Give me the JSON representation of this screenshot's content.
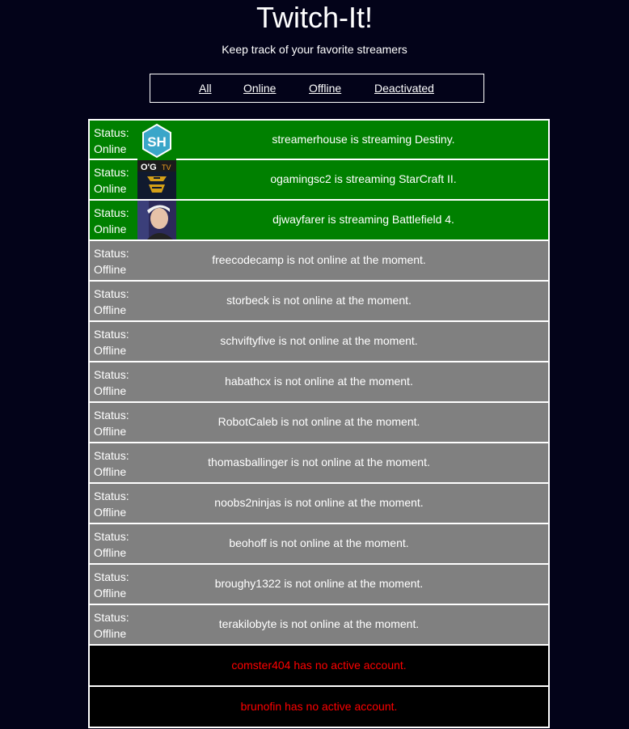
{
  "header": {
    "title": "Twitch-It!",
    "subtitle": "Keep track of your favorite streamers"
  },
  "nav": {
    "all": "All",
    "online": "Online",
    "offline": "Offline",
    "deactivated": "Deactivated"
  },
  "status_label": "Status:",
  "streamers": [
    {
      "state": "Online",
      "message": "streamerhouse is streaming Destiny.",
      "avatar": "streamerhouse-logo"
    },
    {
      "state": "Online",
      "message": "ogamingsc2 is streaming StarCraft II.",
      "avatar": "ogamingsc2-logo"
    },
    {
      "state": "Online",
      "message": "djwayfarer is streaming Battlefield 4.",
      "avatar": "djwayfarer-photo"
    },
    {
      "state": "Offline",
      "message": "freecodecamp is not online at the moment."
    },
    {
      "state": "Offline",
      "message": "storbeck is not online at the moment."
    },
    {
      "state": "Offline",
      "message": "schviftyfive is not online at the moment."
    },
    {
      "state": "Offline",
      "message": "habathcx is not online at the moment."
    },
    {
      "state": "Offline",
      "message": "RobotCaleb is not online at the moment."
    },
    {
      "state": "Offline",
      "message": "thomasballinger is not online at the moment."
    },
    {
      "state": "Offline",
      "message": "noobs2ninjas is not online at the moment."
    },
    {
      "state": "Offline",
      "message": "beohoff is not online at the moment."
    },
    {
      "state": "Offline",
      "message": "broughy1322 is not online at the moment."
    },
    {
      "state": "Offline",
      "message": "terakilobyte is not online at the moment."
    }
  ],
  "deactivated": [
    {
      "message": "comster404 has no active account."
    },
    {
      "message": "brunofin has no active account."
    }
  ],
  "colors": {
    "background": "#030319",
    "online": "#008000",
    "offline": "#808080",
    "deactivated": "#000000",
    "error_text": "#ff0000"
  }
}
